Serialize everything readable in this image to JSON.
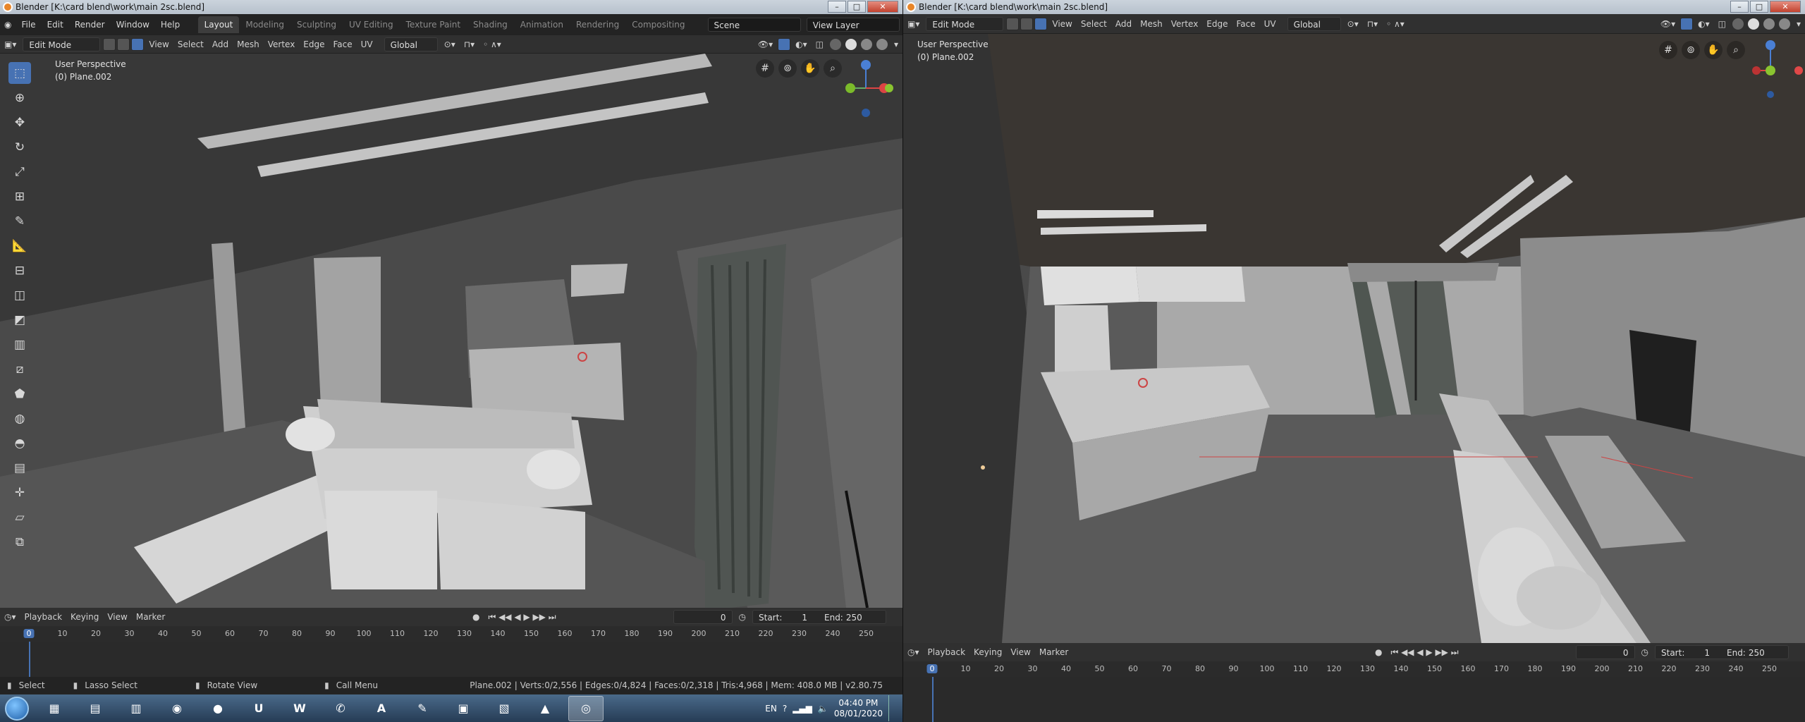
{
  "left": {
    "title": "Blender [K:\\card blend\\work\\main 2sc.blend]",
    "menu": [
      "File",
      "Edit",
      "Render",
      "Window",
      "Help"
    ],
    "workspaces": [
      "Layout",
      "Modeling",
      "Sculpting",
      "UV Editing",
      "Texture Paint",
      "Shading",
      "Animation",
      "Rendering",
      "Compositing"
    ],
    "active_workspace": "Layout",
    "scene": "Scene",
    "view_layer": "View Layer",
    "mode": "Edit Mode",
    "header_menu": [
      "View",
      "Select",
      "Add",
      "Mesh",
      "Vertex",
      "Edge",
      "Face",
      "UV"
    ],
    "orientation": "Global",
    "overlay_title": "User Perspective",
    "overlay_object": "(0) Plane.002",
    "timeline": {
      "menus": [
        "Playback",
        "Keying",
        "View",
        "Marker"
      ],
      "current_frame": "0",
      "start_label": "Start:",
      "start": "1",
      "end_label": "End:",
      "end": "250",
      "ticks": [
        "0",
        "10",
        "20",
        "30",
        "40",
        "50",
        "60",
        "70",
        "80",
        "90",
        "100",
        "110",
        "120",
        "130",
        "140",
        "150",
        "160",
        "170",
        "180",
        "190",
        "200",
        "210",
        "220",
        "230",
        "240",
        "250"
      ]
    },
    "status": {
      "select": "Select",
      "lasso": "Lasso Select",
      "rotate": "Rotate View",
      "menu": "Call Menu",
      "stats": "Plane.002 | Verts:0/2,556 | Edges:0/4,824 | Faces:0/2,318 | Tris:4,968 | Mem: 408.0 MB | v2.80.75"
    }
  },
  "right": {
    "title": "Blender [K:\\card blend\\work\\main 2sc.blend]",
    "mode": "Edit Mode",
    "header_menu": [
      "View",
      "Select",
      "Add",
      "Mesh",
      "Vertex",
      "Edge",
      "Face",
      "UV"
    ],
    "orientation": "Global",
    "overlay_title": "User Perspective",
    "overlay_object": "(0) Plane.002",
    "timeline": {
      "menus": [
        "Playback",
        "Keying",
        "View",
        "Marker"
      ],
      "current_frame": "0",
      "start_label": "Start:",
      "start": "1",
      "end_label": "End:",
      "end": "250",
      "ticks": [
        "0",
        "10",
        "20",
        "30",
        "40",
        "50",
        "60",
        "70",
        "80",
        "90",
        "100",
        "110",
        "120",
        "130",
        "140",
        "150",
        "160",
        "170",
        "180",
        "190",
        "200",
        "210",
        "220",
        "230",
        "240",
        "250"
      ]
    }
  },
  "taskbar": {
    "apps": [
      {
        "name": "network-app",
        "glyph": "▦"
      },
      {
        "name": "explorer-app",
        "glyph": "▤"
      },
      {
        "name": "notes-app",
        "glyph": "▥"
      },
      {
        "name": "davinci-app",
        "glyph": "◉"
      },
      {
        "name": "recorder-app",
        "glyph": "●"
      },
      {
        "name": "unreal-app",
        "glyph": "U"
      },
      {
        "name": "word-app",
        "glyph": "W"
      },
      {
        "name": "whatsapp-app",
        "glyph": "✆"
      },
      {
        "name": "acrobat-app",
        "glyph": "A"
      },
      {
        "name": "tool-app",
        "glyph": "✎"
      },
      {
        "name": "screen-app",
        "glyph": "▣"
      },
      {
        "name": "sheet-app",
        "glyph": "▧"
      },
      {
        "name": "vlc-app",
        "glyph": "▲"
      },
      {
        "name": "blender-app",
        "glyph": "◎"
      }
    ],
    "language": "EN",
    "time": "04:40 PM",
    "date": "08/01/2020"
  },
  "colors": {
    "accent": "#4772b3",
    "viewport": "#3f3f3f",
    "header": "#303030"
  }
}
